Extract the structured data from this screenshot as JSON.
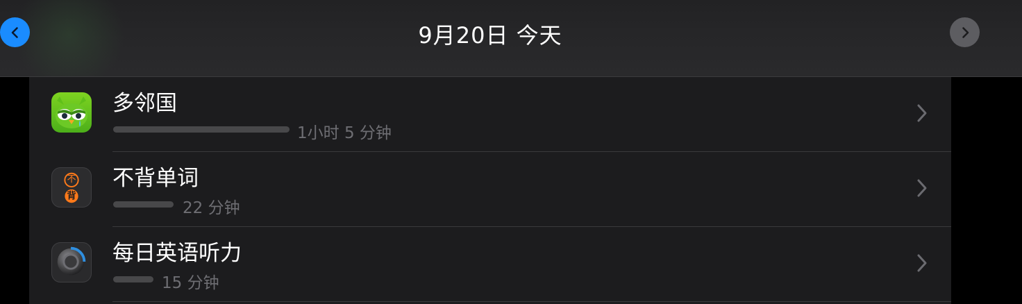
{
  "header": {
    "title": "9月20日 今天",
    "prev_icon": "chevron-left-icon",
    "next_icon": "chevron-right-icon",
    "colors": {
      "prev_button": "#1a8cff",
      "next_button": "#5d5d61"
    }
  },
  "apps": [
    {
      "name": "多邻国",
      "usage": "1小时 5 分钟",
      "usage_fraction": 1.0,
      "icon": "duolingo-icon"
    },
    {
      "name": "不背单词",
      "usage": "22 分钟",
      "usage_fraction": 0.34,
      "icon": "bubeidanci-icon",
      "icon_text": [
        "不",
        "背"
      ]
    },
    {
      "name": "每日英语听力",
      "usage": "15 分钟",
      "usage_fraction": 0.23,
      "icon": "daily-english-listening-icon"
    }
  ]
}
